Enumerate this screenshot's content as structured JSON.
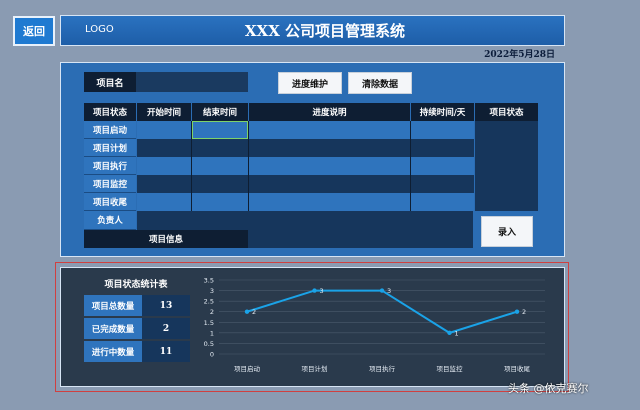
{
  "header": {
    "back_label": "返回",
    "logo": "LOGO",
    "title": "XXX 公司项目管理系统",
    "date": "2022年5月28日"
  },
  "form": {
    "project_name_label": "项目名",
    "btn_progress": "进度维护",
    "btn_clear": "清除数据",
    "btn_entry": "录入",
    "info_label": "项目信息"
  },
  "table": {
    "headers": [
      "项目状态",
      "开始时间",
      "结束时间",
      "进度说明",
      "持续时间/天",
      "项目状态"
    ],
    "rows": [
      "项目启动",
      "项目计划",
      "项目执行",
      "项目监控",
      "项目收尾"
    ],
    "owner_label": "负责人"
  },
  "stats": {
    "title": "项目状态统计表",
    "items": [
      {
        "label": "项目总数量",
        "value": "13"
      },
      {
        "label": "已完成数量",
        "value": "2"
      },
      {
        "label": "进行中数量",
        "value": "11"
      }
    ]
  },
  "chart_data": {
    "type": "line",
    "categories": [
      "项目启动",
      "项目计划",
      "项目执行",
      "项目监控",
      "项目收尾"
    ],
    "values": [
      2,
      3,
      3,
      1,
      2
    ],
    "ylim": [
      0,
      3.5
    ],
    "yticks": [
      "0",
      "0.5",
      "1",
      "1.5",
      "2",
      "2.5",
      "3",
      "3.5"
    ],
    "grid": true,
    "color": "#1aa3e8"
  },
  "watermark": "头条 @依克赛尔"
}
